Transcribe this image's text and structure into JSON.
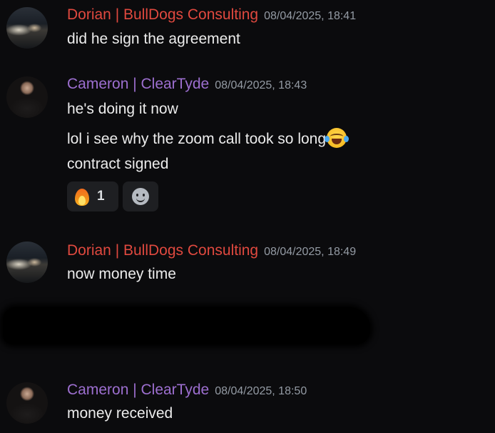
{
  "messages": [
    {
      "author": "Dorian | BullDogs Consulting",
      "author_color": "#e0493f",
      "timestamp": "08/04/2025, 18:41",
      "lines": [
        "did he sign the agreement"
      ]
    },
    {
      "author": "Cameron | ClearTyde",
      "author_color": "#9d6fd0",
      "timestamp": "08/04/2025, 18:43",
      "lines": [
        "he's doing it now",
        "lol i see why the zoom call took so long",
        "contract signed"
      ],
      "reactions": [
        {
          "icon": "fire-icon",
          "count": "1"
        }
      ]
    },
    {
      "author": "Dorian | BullDogs Consulting",
      "author_color": "#e0493f",
      "timestamp": "08/04/2025, 18:49",
      "lines": [
        "now money time"
      ]
    },
    {
      "author": "Cameron | ClearTyde",
      "author_color": "#9d6fd0",
      "timestamp": "08/04/2025, 18:50",
      "lines": [
        "money received"
      ]
    }
  ],
  "icons": {
    "laugh_emoji": "laughing-tears-emoji-icon",
    "add_reaction": "add-reaction-icon"
  }
}
